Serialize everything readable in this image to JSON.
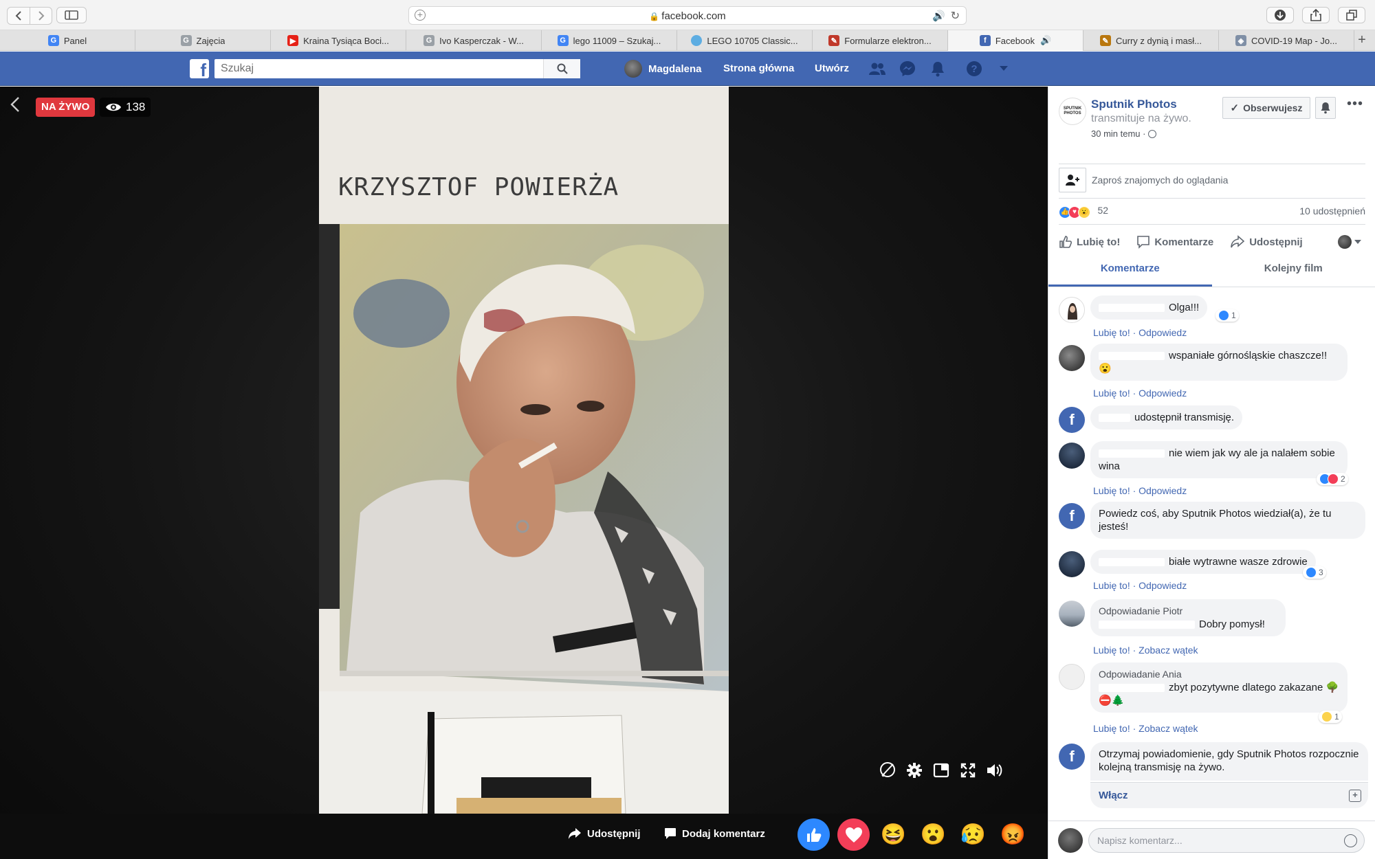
{
  "browser": {
    "url": "facebook.com",
    "tabs": [
      {
        "label": "Panel",
        "icon": "google-icon",
        "color": "#4285f4",
        "glyph": "G"
      },
      {
        "label": "Zajęcia",
        "icon": "classroom-icon",
        "color": "#9aa0a6",
        "glyph": "G"
      },
      {
        "label": "Kraina Tysiąca Boci...",
        "icon": "youtube-icon",
        "color": "#e62117",
        "glyph": "▶"
      },
      {
        "label": "Ivo Kasperczak - W...",
        "icon": "site-icon",
        "color": "#9aa0a6",
        "glyph": "G"
      },
      {
        "label": "lego 11009 – Szukaj...",
        "icon": "google-icon",
        "color": "#4285f4",
        "glyph": "G"
      },
      {
        "label": "LEGO 10705 Classic...",
        "icon": "circle-site-icon",
        "color": "#5dade2",
        "glyph": ""
      },
      {
        "label": "Formularze elektron...",
        "icon": "pen-icon",
        "color": "#c0392b",
        "glyph": "✎"
      },
      {
        "label": "Facebook",
        "icon": "facebook-icon",
        "color": "#4267b2",
        "glyph": "f",
        "active": true,
        "audio": true
      },
      {
        "label": "Curry z dynią i masł...",
        "icon": "food-icon",
        "color": "#b9770e",
        "glyph": "✎"
      },
      {
        "label": "COVID-19 Map - Jo...",
        "icon": "shield-icon",
        "color": "#7f8fa6",
        "glyph": "◈"
      }
    ]
  },
  "fb": {
    "search_placeholder": "Szukaj",
    "user": "Magdalena",
    "home": "Strona główna",
    "create": "Utwórz",
    "brand_color": "#4267b2"
  },
  "video": {
    "live_label": "NA ŻYWO",
    "viewers": "138",
    "photo_title": "KRZYSZTOF POWIERŻA",
    "share_label": "Udostępnij",
    "comment_label": "Dodaj komentarz",
    "reactions": [
      "like",
      "love",
      "haha",
      "wow",
      "sad",
      "angry"
    ]
  },
  "panel": {
    "page_name": "Sputnik Photos",
    "logo_text": "SPUTNIK PHOTOS",
    "subtitle": "transmituje na żywo.",
    "time": "30 min temu ·",
    "follow_label": "Obserwujesz",
    "invite_text": "Zaproś znajomych do oglądania",
    "reactions_count": "52",
    "shares": "10 udostępnień",
    "like": "Lubię to!",
    "comment": "Komentarze",
    "share": "Udostępnij",
    "tab_comments": "Komentarze",
    "tab_next": "Kolejny film",
    "composer_placeholder": "Napisz komentarz..."
  },
  "comments": [
    {
      "text": "Olga!!!",
      "like": "Lubię to!",
      "reply": "Odpowiedz",
      "reaction_count": "1"
    },
    {
      "text": "wspaniałe górnośląskie chaszcze!! 😮",
      "like": "Lubię to!",
      "reply": "Odpowiedz"
    },
    {
      "text": "udostępnił transmisję."
    },
    {
      "text": "nie wiem jak wy ale ja nalałem sobie wina",
      "like": "Lubię to!",
      "reply": "Odpowiedz",
      "reaction_count": "2"
    },
    {
      "text": "Powiedz coś, aby Sputnik Photos wiedział(a), że tu jesteś!"
    },
    {
      "text": "białe wytrawne wasze zdrowie",
      "like": "Lubię to!",
      "reply": "Odpowiedz",
      "reaction_count": "3"
    },
    {
      "header": "Odpowiadanie Piotr",
      "text": "Dobry pomysł!",
      "like": "Lubię to!",
      "reply": "Zobacz wątek"
    },
    {
      "header": "Odpowiadanie Ania",
      "text": "zbyt pozytywne dlatego zakazane 🌳⛔🌲",
      "like": "Lubię to!",
      "reply": "Zobacz wątek",
      "reaction_count": "1"
    },
    {
      "text": "Otrzymaj powiadomienie, gdy Sputnik Photos rozpocznie kolejną transmisję na żywo.",
      "enable": "Włącz"
    }
  ]
}
